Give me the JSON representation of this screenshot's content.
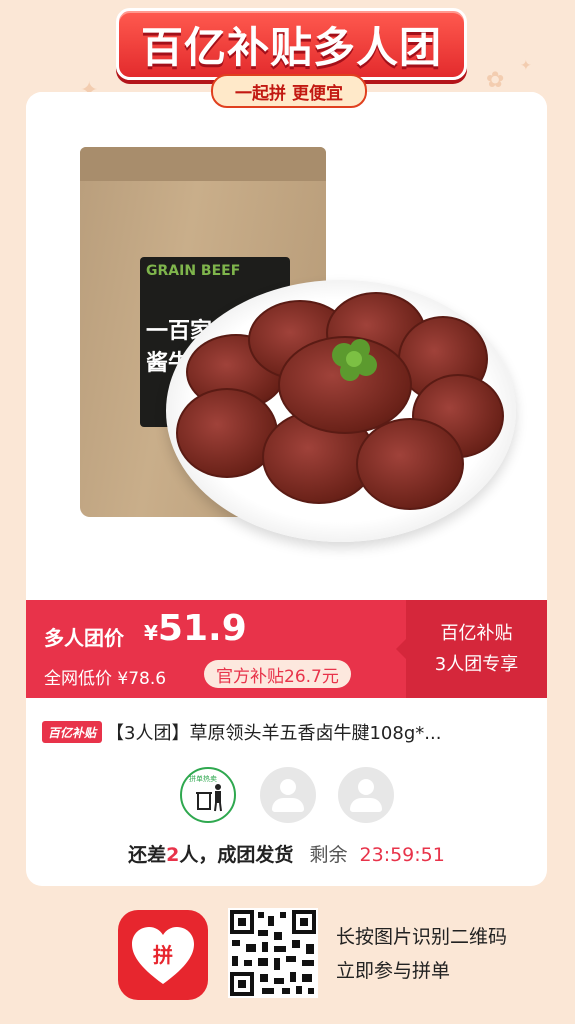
{
  "banner": {
    "title": "百亿补贴多人团",
    "subtitle": "一起拼 更便宜"
  },
  "product": {
    "bag_label_top": "GRAIN BEEF",
    "bag_label_main": "一百家八钱 酱牛肉",
    "title": "【3人团】草原领头羊五香卤牛腱108g*..."
  },
  "price_bar": {
    "group_price_label": "多人团价",
    "currency": "¥",
    "group_price": "51.9",
    "market_low_label": "全网低价",
    "market_low_price": "¥78.6",
    "subsidy_label": "官方补贴26.7元",
    "right_line1": "百亿补贴",
    "right_line2": "3人团专享"
  },
  "badge": {
    "label": "百亿补贴"
  },
  "group": {
    "leader_tag": "拼单热卖",
    "status_prefix": "还差",
    "missing_count": "2",
    "status_suffix": "人，成团发货",
    "remaining_label": "剩余",
    "timer": "23:59:51"
  },
  "footer": {
    "app_icon_text": "拼",
    "scan_line1": "长按图片识别二维码",
    "scan_line2": "立即参与拼单"
  },
  "colors": {
    "brand_red": "#e8334a",
    "banner_red": "#e32b2d",
    "background": "#fbe7d6"
  }
}
